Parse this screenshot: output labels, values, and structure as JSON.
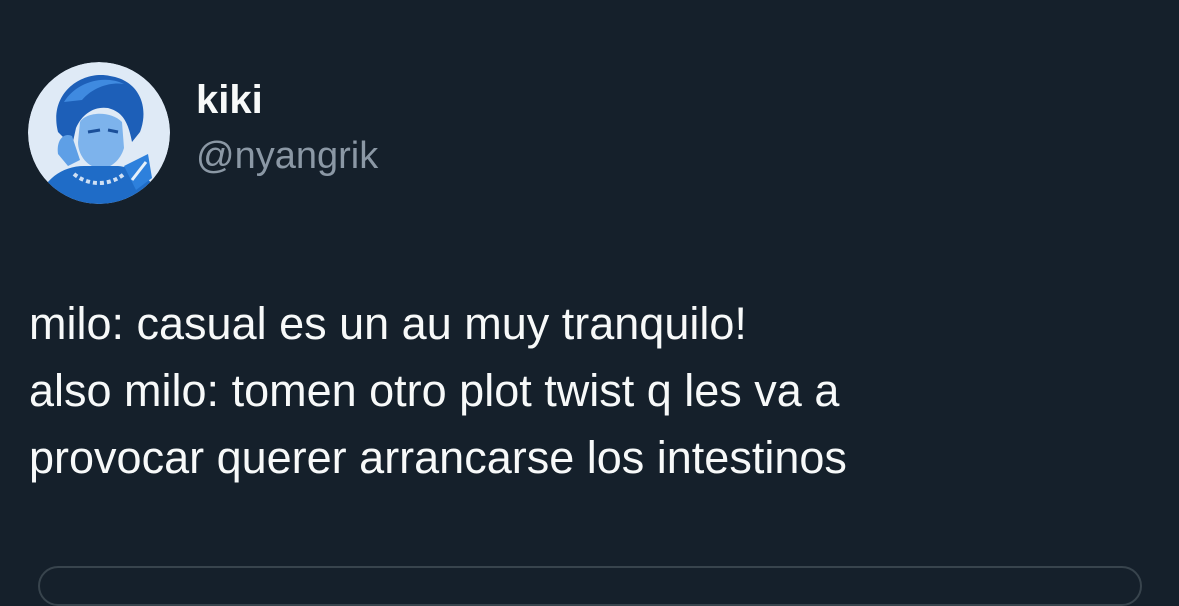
{
  "tweet": {
    "author": {
      "display_name": "kiki",
      "handle": "@nyangrik",
      "avatar": "profile-photo"
    },
    "text_lines": [
      "milo: casual es un au muy tranquilo!",
      "also milo: tomen otro plot twist q les va a",
      "provocar querer arrancarse los intestinos"
    ]
  },
  "colors": {
    "background": "#15202b",
    "text": "#f7f9f9",
    "secondary_text": "#8b98a5",
    "avatar_tint": "#2f7fd6"
  }
}
